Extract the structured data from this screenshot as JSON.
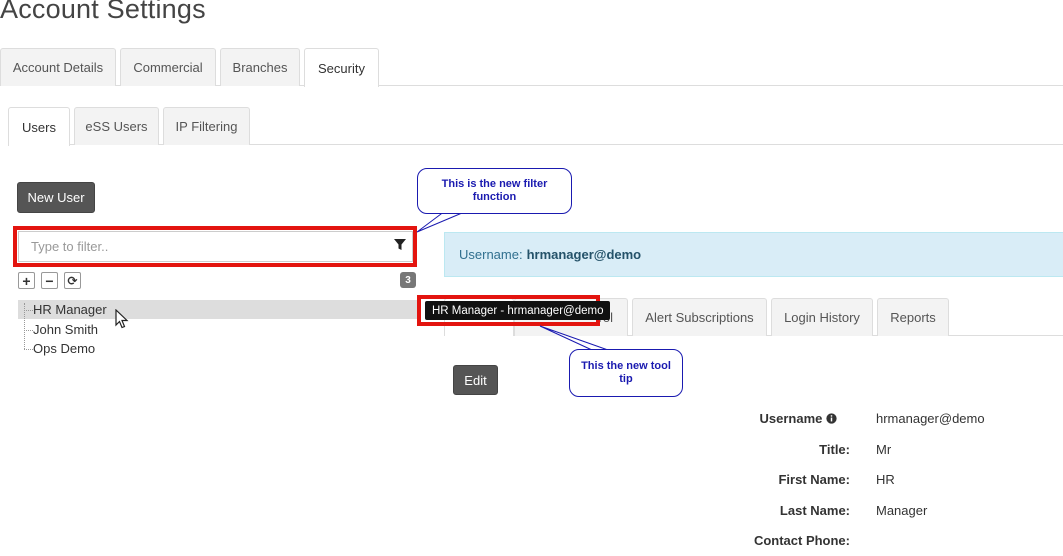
{
  "page": {
    "title": "Account Settings"
  },
  "main_tabs": [
    {
      "label": "Account Details"
    },
    {
      "label": "Commercial"
    },
    {
      "label": "Branches"
    },
    {
      "label": "Security"
    }
  ],
  "sub_tabs": [
    {
      "label": "Users"
    },
    {
      "label": "eSS Users"
    },
    {
      "label": "IP Filtering"
    }
  ],
  "users_panel": {
    "new_user_label": "New User",
    "filter_placeholder": "Type to filter..",
    "filter_value": "",
    "toolbar": {
      "expand_symbol": "+",
      "collapse_symbol": "−",
      "refresh_symbol": "⟳"
    },
    "count": "3",
    "users": [
      {
        "name": "HR Manager",
        "selected": true
      },
      {
        "name": "John Smith",
        "selected": false
      },
      {
        "name": "Ops Demo",
        "selected": false
      }
    ]
  },
  "detail": {
    "banner_prefix": "Username:",
    "banner_username": "hrmanager@demo",
    "tabs": [
      {
        "label": "rol"
      },
      {
        "label": "Alert Subscriptions"
      },
      {
        "label": "Login History"
      },
      {
        "label": "Reports"
      }
    ],
    "edit_label": "Edit",
    "fields": [
      {
        "label": "Username",
        "value": "hrmanager@demo"
      },
      {
        "label": "Title:",
        "value": "Mr"
      },
      {
        "label": "First Name:",
        "value": "HR"
      },
      {
        "label": "Last Name:",
        "value": "Manager"
      },
      {
        "label": "Contact Phone:",
        "value": ""
      }
    ]
  },
  "tooltip": {
    "text": "HR Manager - hrmanager@demo"
  },
  "annotations": {
    "filter_callout": "This is the new filter function",
    "tooltip_callout": "This the new tool tip"
  },
  "colors": {
    "highlight": "#e3140f",
    "callout_text": "#1a1ab0",
    "banner_bg": "#d9edf7",
    "button_dark": "#555555"
  }
}
